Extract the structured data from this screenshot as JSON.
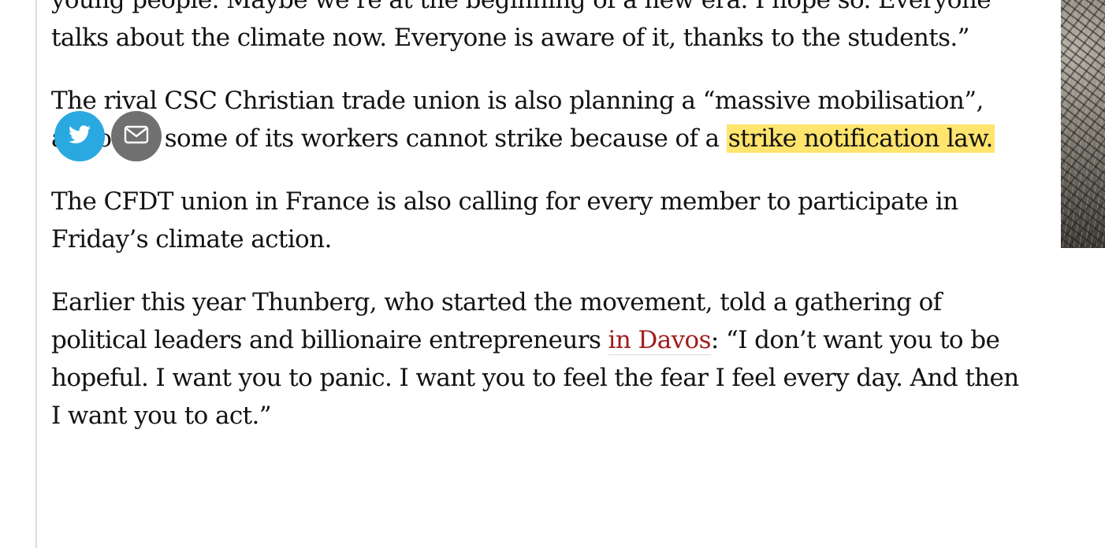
{
  "article": {
    "paragraphs": [
      {
        "parts": [
          {
            "text": "young people. Maybe we’re at the beginning of a new era. I hope so. Everyone talks about the climate now. Everyone is aware of it, thanks to the students.”"
          }
        ]
      },
      {
        "parts": [
          {
            "text": "The rival CSC Christian trade union is also planning a “massive mobilisation”, although some of its workers cannot strike because of a "
          },
          {
            "text": "strike notification law.",
            "style": "highlight"
          }
        ]
      },
      {
        "parts": [
          {
            "text": "The CFDT union in France is also calling for every member to participate in Friday’s climate action."
          }
        ]
      },
      {
        "parts": [
          {
            "text": "Earlier this year Thunberg, who started the movement, told a gathering of political leaders and billionaire entrepreneurs "
          },
          {
            "text": "in Davos",
            "style": "link"
          },
          {
            "text": ": “I don’t want you to be hopeful. I want you to panic. I want you to feel the fear I feel every day. And then I want you to act.”"
          }
        ]
      }
    ]
  },
  "share_bar": {
    "buttons": [
      {
        "name": "share-twitter-button",
        "icon": "twitter-bird-icon",
        "color": "#2aa9e0"
      },
      {
        "name": "share-email-button",
        "icon": "envelope-icon",
        "color": "#707070"
      }
    ]
  },
  "colors": {
    "text": "#121212",
    "link": "#a11d1b",
    "highlight": "#ffe46e"
  }
}
